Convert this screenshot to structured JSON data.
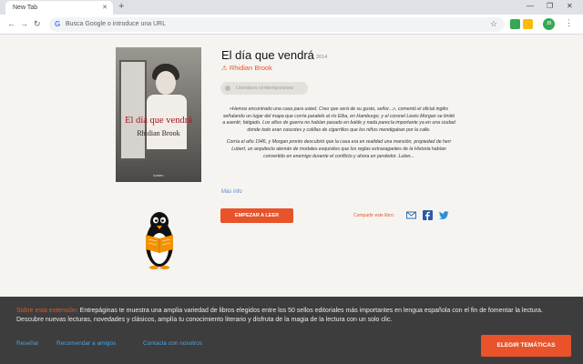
{
  "browser": {
    "tab_title": "New Tab",
    "tab_close": "✕",
    "new_tab": "+",
    "window_controls": [
      "—",
      "❐",
      "✕"
    ],
    "omnibox_placeholder": "Busca Google o introduce una URL",
    "avatar_initials": "JB"
  },
  "book": {
    "title": "El día que vendrá",
    "year": "2014",
    "author": "Rhidian Brook",
    "genre": "Literatura contemporánea",
    "cover_title": "El día que vendrá",
    "cover_author": "Rhidian Brook",
    "cover_publisher": "lumen",
    "synopsis": [
      "«Hemos encontrado una casa para usted. Creo que será de su gusto, señor...», comentó el oficial inglés señalando un lugar del mapa que corría paralelo al río Elba, en Hamburgo, y el coronel Lewis Morgan se limitó a asentir, fatigado. Los años de guerra no habían pasado en balde y nada parecía importante ya en una ciudad donde todo eran cascotes y colillas de cigarrillos que los niños mendigaban por la calle.",
      "Corría el año 1946, y Morgan pronto descubrió que la casa era en realidad una mansión, propiedad de herr Lubert, un arquitecto alemán de modales exquisitos que los reglas extravagantes de la Historia habían convertido en enemigo durante el conflicto y ahora en perdedor. Luber..."
    ],
    "more_info": "Más info",
    "start_button": "EMPEZAR A LEER",
    "share_label": "Compartir este libro:"
  },
  "info_bar": {
    "label": "Sobre esta extensión:",
    "text": " Entrepáginas te muestra una amplia variedad de libros elegidos entre los 50 sellos editoriales más importantes en lengua española con el fin de fomentar la lectura. Descubre nuevas lecturas, novedades y clásicos, amplía tu conocimiento literario y disfruta de la magia de la lectura con un solo clic.",
    "links": [
      "Reseñar",
      "Recomendar a amigos",
      "Contacta con nosotros"
    ],
    "themes_button": "ELEGIR TEMÁTICAS"
  },
  "colors": {
    "accent": "#e8532a",
    "link": "#4aa3df",
    "page_bg": "#f6f4f1",
    "info_bar_bg": "#3d3d3d"
  }
}
